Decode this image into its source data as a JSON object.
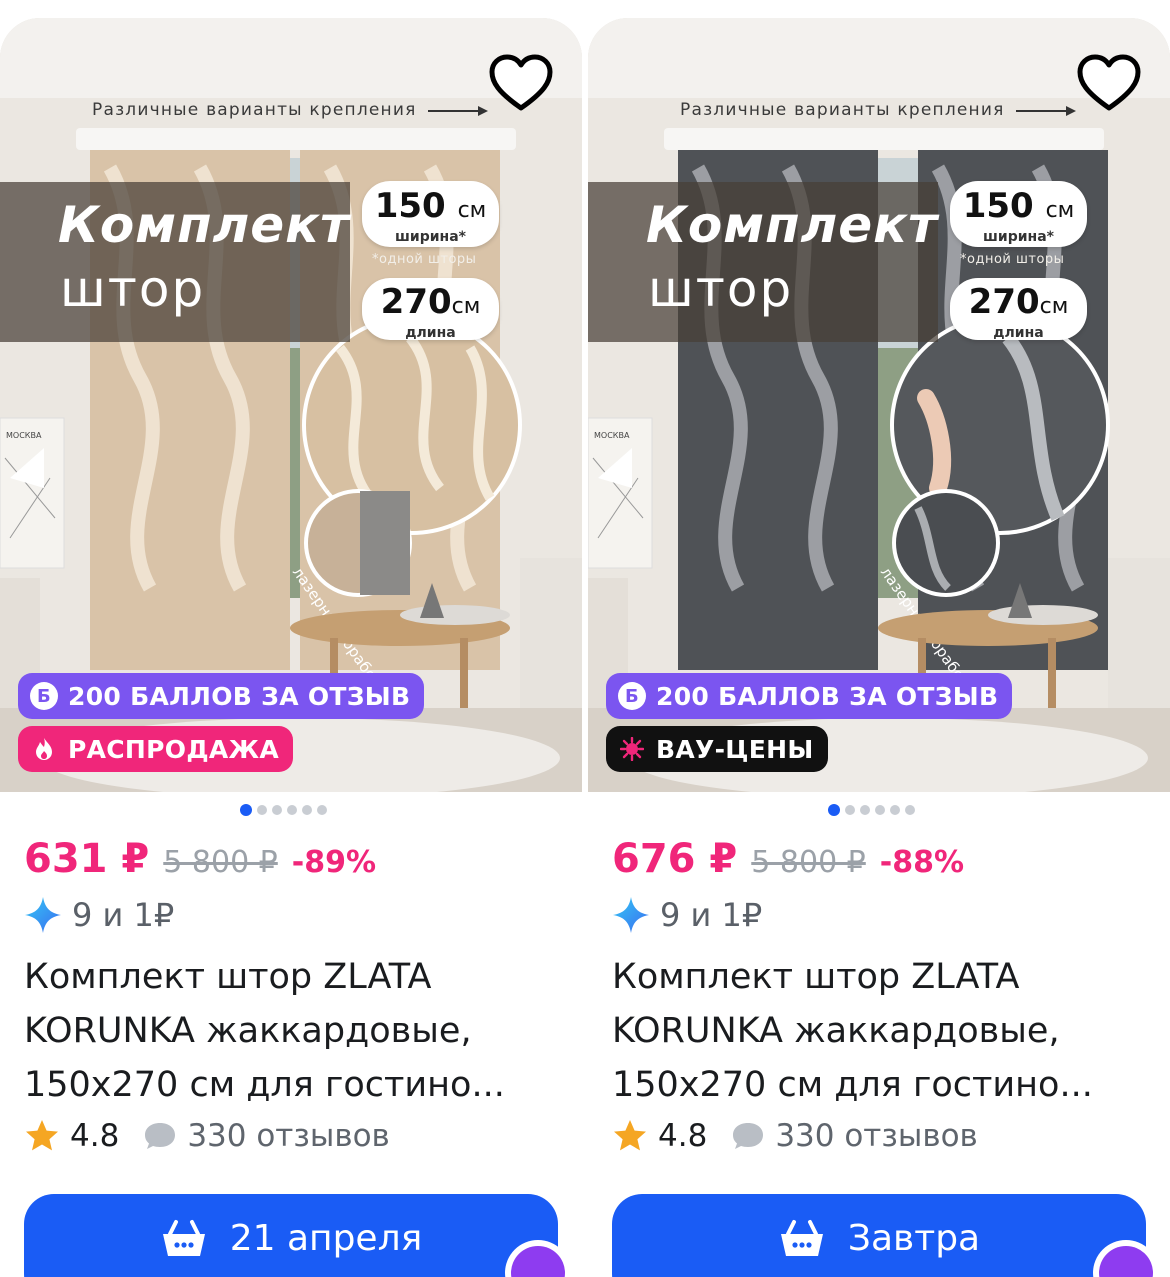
{
  "products": [
    {
      "image": {
        "caption": "Различные варианты крепления",
        "title_line1": "Комплект",
        "title_line2": "штор",
        "width_value": "150",
        "width_unit": "см",
        "width_label": "ширина*",
        "width_note": "*одной шторы",
        "length_value": "270",
        "length_unit": "см",
        "length_label": "длина",
        "laser_label": "лазерная обработка",
        "poster_text": "МОСКВА",
        "curtain_color": "#d9c3a8",
        "pattern_color": "#f4ead9"
      },
      "promo_points": "200 БАЛЛОВ ЗА ОТЗЫВ",
      "promo_points_icon": "Б",
      "promo_sale": "РАСПРОДАЖА",
      "promo_sale_icon": "fire-icon",
      "price": "631 ₽",
      "old_price": "5 800 ₽",
      "discount": "-89%",
      "bonus": "9 и 1₽",
      "name": "Комплект штор ZLATA KORUNKA жаккардовые, 150х270 см для гостино...",
      "rating": "4.8",
      "reviews": "330 отзывов",
      "cart_label": "21 апреля",
      "carousel": {
        "count": 6,
        "active": 0
      }
    },
    {
      "image": {
        "caption": "Различные варианты крепления",
        "title_line1": "Комплект",
        "title_line2": "штор",
        "width_value": "150",
        "width_unit": "см",
        "width_label": "ширина*",
        "width_note": "*одной шторы",
        "length_value": "270",
        "length_unit": "см",
        "length_label": "длина",
        "laser_label": "лазерная обработка",
        "poster_text": "МОСКВА",
        "curtain_color": "#4f5256",
        "pattern_color": "#a9acb0"
      },
      "promo_points": "200 БАЛЛОВ ЗА ОТЗЫВ",
      "promo_points_icon": "Б",
      "promo_sale": "ВАУ-ЦЕНЫ",
      "promo_sale_icon": "sparkle-icon",
      "price": "676 ₽",
      "old_price": "5 800 ₽",
      "discount": "-88%",
      "bonus": "9 и 1₽",
      "name": "Комплект штор ZLATA KORUNKA жаккардовые, 150х270 см для гостино...",
      "rating": "4.8",
      "reviews": "330 отзывов",
      "cart_label": "Завтра",
      "carousel": {
        "count": 6,
        "active": 0
      }
    }
  ],
  "colors": {
    "price_pink": "#f0267a",
    "points_purple": "#7b55f0",
    "wow_black": "#111111",
    "cart_blue": "#1a5cf5",
    "star": "#f5a623"
  }
}
